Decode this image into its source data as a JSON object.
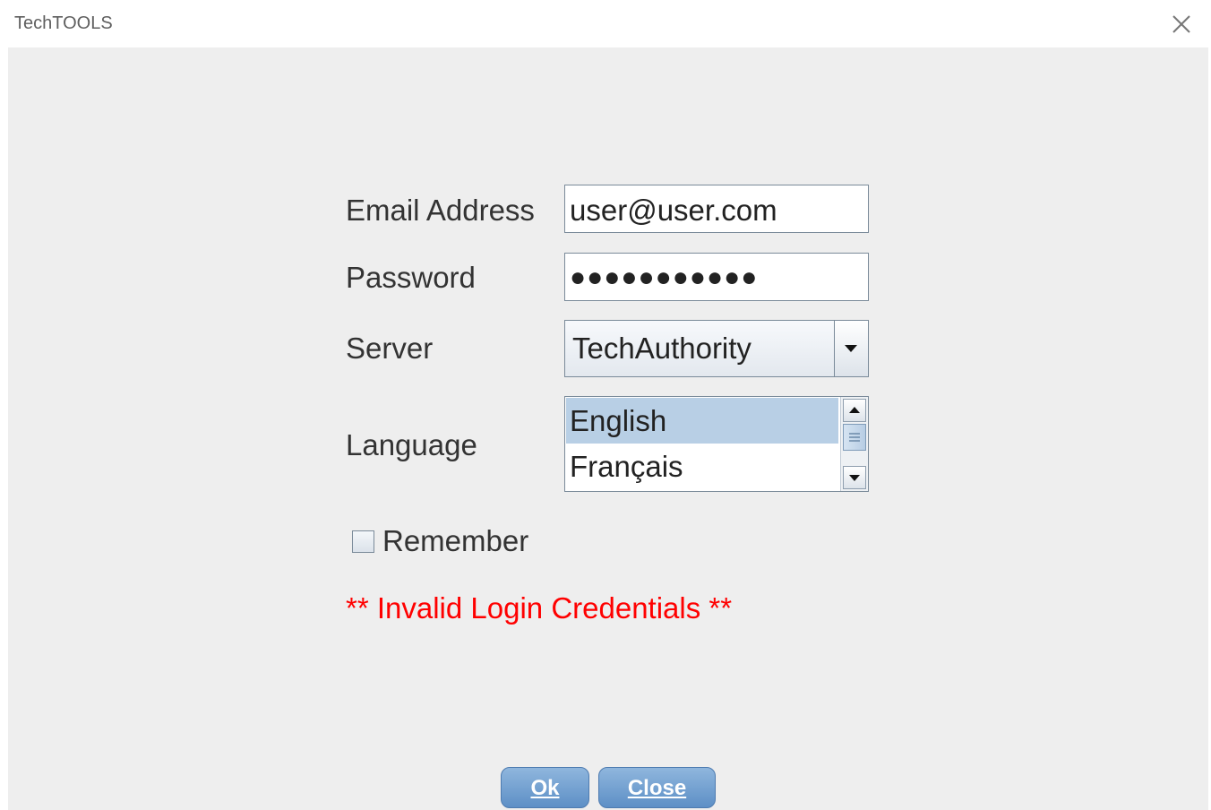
{
  "window": {
    "title": "TechTOOLS"
  },
  "form": {
    "email_label": "Email Address",
    "email_value": "user@user.com",
    "password_label": "Password",
    "password_value": "●●●●●●●●●●●",
    "server_label": "Server",
    "server_value": "TechAuthority",
    "language_label": "Language",
    "languages": [
      {
        "label": "English",
        "selected": true
      },
      {
        "label": "Français",
        "selected": false
      }
    ],
    "remember_label": "Remember",
    "remember_checked": false,
    "error_message": "** Invalid Login Credentials **"
  },
  "buttons": {
    "ok_label": "Ok",
    "close_label": "Close"
  },
  "icons": {
    "close": "close-icon",
    "dropdown": "chevron-down-icon",
    "scroll_up": "scroll-up-arrow-icon",
    "scroll_down": "scroll-down-arrow-icon"
  },
  "colors": {
    "error": "#ff0000",
    "selection": "#b8cfe5",
    "button": "#6f9dd0",
    "background": "#eeeeee"
  }
}
